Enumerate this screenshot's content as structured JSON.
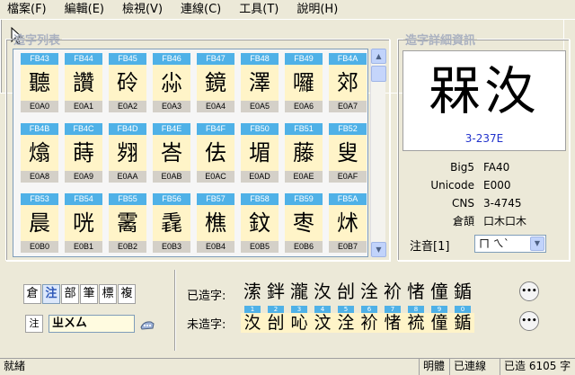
{
  "menu": [
    "檔案(F)",
    "編輯(E)",
    "檢視(V)",
    "連線(C)",
    "工具(T)",
    "說明(H)"
  ],
  "list_group": {
    "title": "造字列表"
  },
  "detail_group": {
    "title": "造字詳細資訊"
  },
  "grid": {
    "rows": [
      [
        {
          "top": "FB43",
          "char": "聽",
          "bottom": "E0A0"
        },
        {
          "top": "FB44",
          "char": "讚",
          "bottom": "E0A1"
        },
        {
          "top": "FB45",
          "char": "砱",
          "bottom": "E0A2"
        },
        {
          "top": "FB46",
          "char": "尛",
          "bottom": "E0A3"
        },
        {
          "top": "FB47",
          "char": "鏡",
          "bottom": "E0A4"
        },
        {
          "top": "FB48",
          "char": "澤",
          "bottom": "E0A5"
        },
        {
          "top": "FB49",
          "char": "囉",
          "bottom": "E0A6"
        },
        {
          "top": "FB4A",
          "char": "郊",
          "bottom": "E0A7"
        }
      ],
      [
        {
          "top": "FB4B",
          "char": "熻",
          "bottom": "E0A8"
        },
        {
          "top": "FB4C",
          "char": "蒔",
          "bottom": "E0A9"
        },
        {
          "top": "FB4D",
          "char": "翙",
          "bottom": "E0AA"
        },
        {
          "top": "FB4E",
          "char": "峇",
          "bottom": "E0AB"
        },
        {
          "top": "FB4F",
          "char": "佉",
          "bottom": "E0AC"
        },
        {
          "top": "FB50",
          "char": "堳",
          "bottom": "E0AD"
        },
        {
          "top": "FB51",
          "char": "藤",
          "bottom": "E0AE"
        },
        {
          "top": "FB52",
          "char": "叟",
          "bottom": "E0AF"
        }
      ],
      [
        {
          "top": "FB53",
          "char": "晨",
          "bottom": "E0B0"
        },
        {
          "top": "FB54",
          "char": "咣",
          "bottom": "E0B1"
        },
        {
          "top": "FB55",
          "char": "霱",
          "bottom": "E0B2"
        },
        {
          "top": "FB56",
          "char": "毳",
          "bottom": "E0B3"
        },
        {
          "top": "FB57",
          "char": "樵",
          "bottom": "E0B4"
        },
        {
          "top": "FB58",
          "char": "鈫",
          "bottom": "E0B5"
        },
        {
          "top": "FB59",
          "char": "枣",
          "bottom": "E0B6"
        },
        {
          "top": "FB5A",
          "char": "炢",
          "bottom": "E0B7"
        }
      ]
    ]
  },
  "detail": {
    "big_chars": "槑汷",
    "cns_code": "3-237E",
    "fields": [
      {
        "label": "Big5",
        "value": "FA40"
      },
      {
        "label": "Unicode",
        "value": "E000"
      },
      {
        "label": "CNS",
        "value": "3-4745"
      },
      {
        "label": "倉頡",
        "value": "口木口木"
      }
    ],
    "zhuyin_label": "注音[1]",
    "zhuyin_value": "ㄇ ㄟˋ"
  },
  "methods": [
    "倉",
    "注",
    "部",
    "筆",
    "標",
    "複"
  ],
  "input": {
    "label": "注",
    "value": "ㄓㄨㄙ"
  },
  "made": {
    "label": "已造字:",
    "chars": [
      "溹",
      "鉡",
      "瀧",
      "汷",
      "刣",
      "洤",
      "衸",
      "㥩",
      "僮",
      "鍎"
    ]
  },
  "unmade": {
    "label": "未造字:",
    "items": [
      {
        "num": "1",
        "char": "汷"
      },
      {
        "num": "2",
        "char": "刣"
      },
      {
        "num": "3",
        "char": "吣"
      },
      {
        "num": "4",
        "char": "汶"
      },
      {
        "num": "5",
        "char": "洤"
      },
      {
        "num": "6",
        "char": "衸"
      },
      {
        "num": "7",
        "char": "㥩"
      },
      {
        "num": "8",
        "char": "裗"
      },
      {
        "num": "9",
        "char": "僮"
      },
      {
        "num": "0",
        "char": "鍎"
      }
    ]
  },
  "status": {
    "left": "就緒",
    "font": "明體",
    "conn": "已連線",
    "count": "已造 6105 字"
  }
}
